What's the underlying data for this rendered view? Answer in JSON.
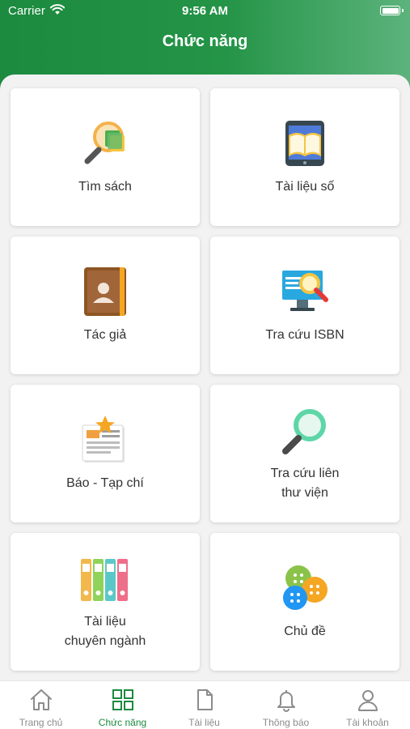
{
  "status_bar": {
    "carrier": "Carrier",
    "time": "9:56 AM"
  },
  "header": {
    "title": "Chức năng"
  },
  "features": [
    {
      "label": "Tìm sách",
      "icon": "book-search-icon"
    },
    {
      "label": "Tài liệu số",
      "icon": "digital-document-icon"
    },
    {
      "label": "Tác giả",
      "icon": "author-contact-book-icon"
    },
    {
      "label": "Tra cứu ISBN",
      "icon": "isbn-lookup-monitor-icon"
    },
    {
      "label": "Báo - Tạp chí",
      "icon": "newspaper-icon"
    },
    {
      "label": "Tra cứu liên\nthư viện",
      "icon": "magnifier-icon"
    },
    {
      "label": "Tài liệu\nchuyên ngành",
      "icon": "binders-icon"
    },
    {
      "label": "Chủ đề",
      "icon": "buttons-icon"
    }
  ],
  "tabbar": {
    "active_color": "#1c8a3f",
    "items": [
      {
        "label": "Trang chủ",
        "icon": "home-icon"
      },
      {
        "label": "Chức năng",
        "icon": "grid-icon"
      },
      {
        "label": "Tài liệu",
        "icon": "document-icon"
      },
      {
        "label": "Thông báo",
        "icon": "bell-icon"
      },
      {
        "label": "Tài khoản",
        "icon": "user-icon"
      }
    ],
    "active_index": 1
  }
}
